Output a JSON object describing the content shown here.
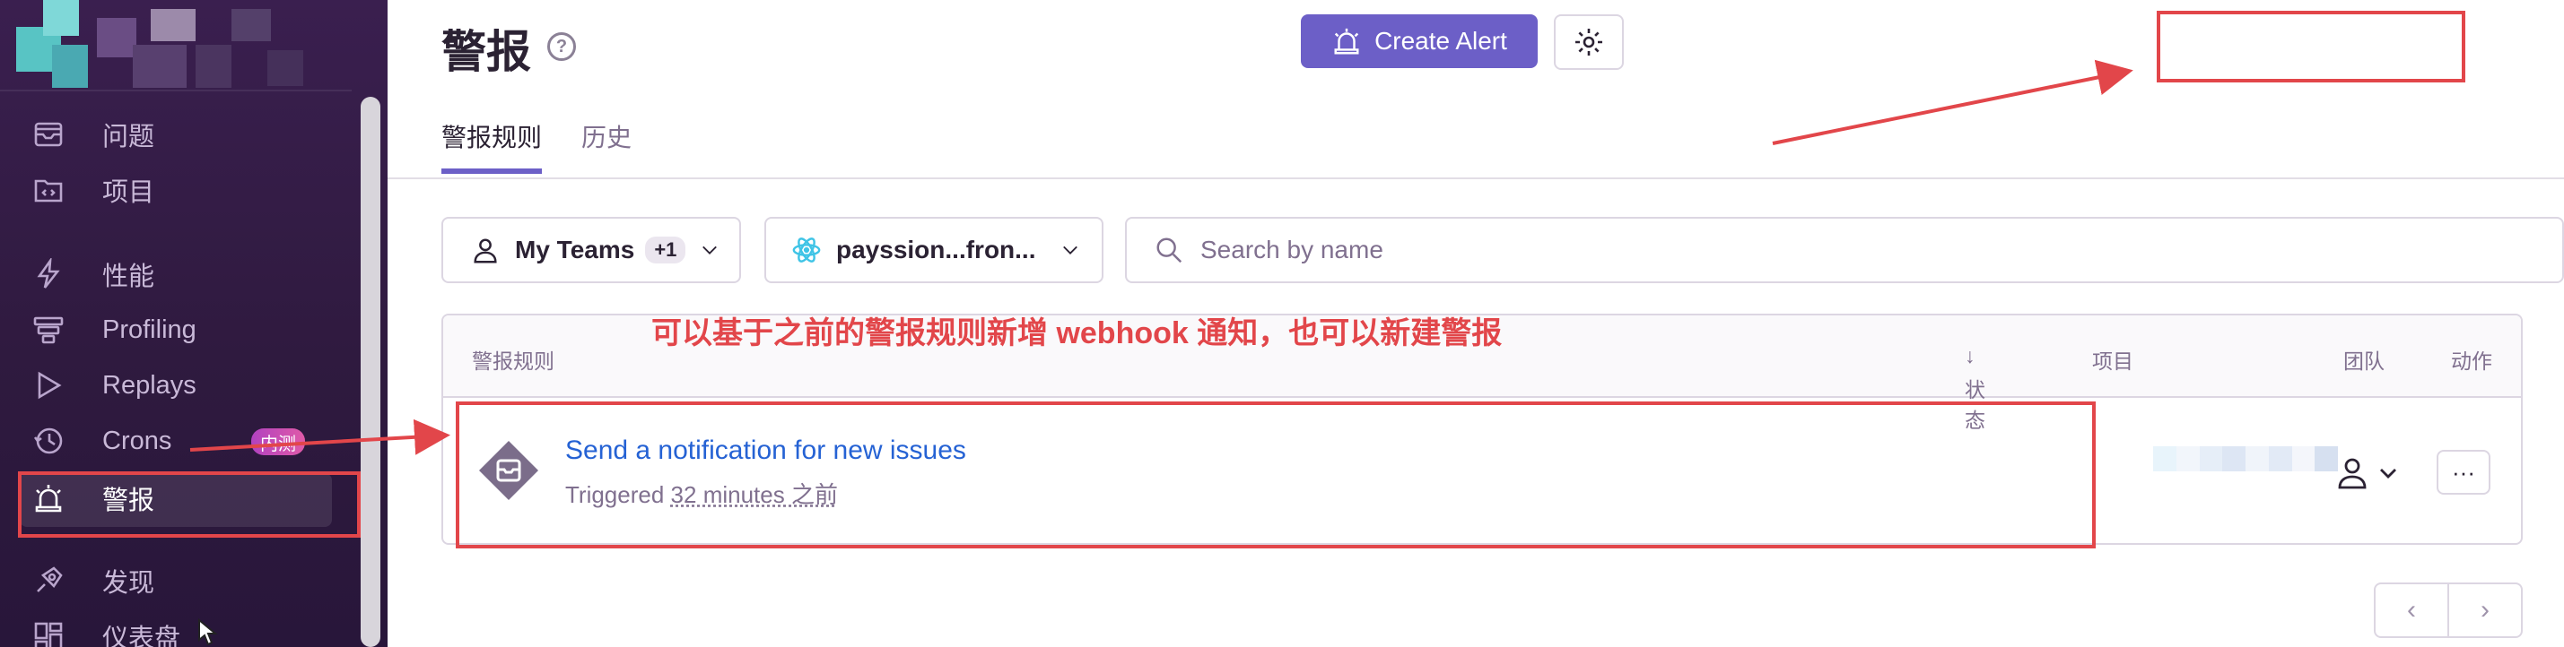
{
  "sidebar": {
    "items": [
      {
        "label": "问题",
        "icon": "issues-icon"
      },
      {
        "label": "项目",
        "icon": "projects-icon"
      },
      {
        "label": "性能",
        "icon": "performance-icon"
      },
      {
        "label": "Profiling",
        "icon": "profiling-icon"
      },
      {
        "label": "Replays",
        "icon": "replays-icon"
      },
      {
        "label": "Crons",
        "icon": "crons-icon",
        "badge": "内测"
      },
      {
        "label": "警报",
        "icon": "alerts-icon",
        "active": true
      },
      {
        "label": "发现",
        "icon": "discover-icon"
      },
      {
        "label": "仪表盘",
        "icon": "dashboards-icon"
      }
    ]
  },
  "header": {
    "title": "警报",
    "help": "?",
    "create_label": "Create Alert"
  },
  "tabs": [
    {
      "label": "警报规则",
      "active": true
    },
    {
      "label": "历史",
      "active": false
    }
  ],
  "filters": {
    "teams_label": "My Teams",
    "teams_count": "+1",
    "project_label": "payssion...fron...",
    "search_placeholder": "Search by name"
  },
  "table": {
    "headers": {
      "name": "警报规则",
      "status": "状态",
      "project": "项目",
      "team": "团队",
      "actions": "动作"
    },
    "rows": [
      {
        "name": "Send a notification for new issues",
        "triggered_prefix": "Triggered",
        "triggered_time": "32 minutes 之前",
        "actions": "···"
      }
    ]
  },
  "annotation": {
    "text": "可以基于之前的警报规则新增 webhook 通知，也可以新建警报",
    "color": "#e2464a"
  },
  "colors": {
    "accent": "#6c5fc7",
    "link": "#2562d4",
    "sidebar_bg": "#3a1f4f"
  }
}
